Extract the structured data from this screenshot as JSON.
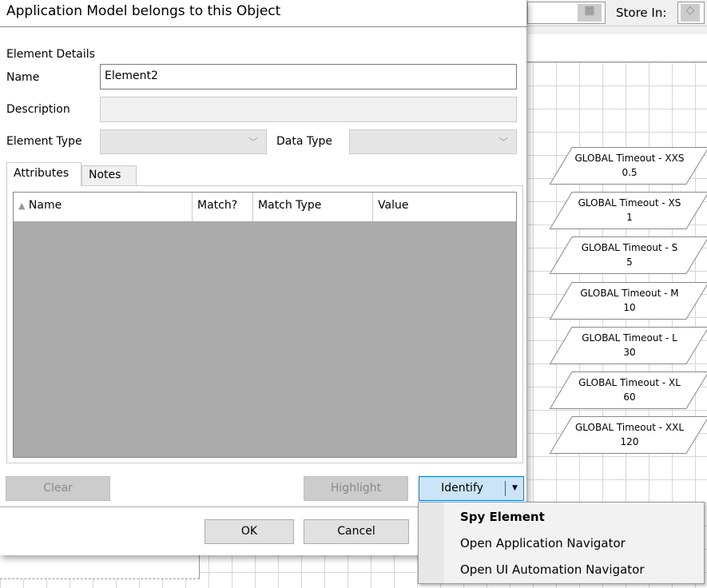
{
  "window": {
    "title": "Application Model belongs to this Object"
  },
  "toolbar": {
    "store_in_label": "Store In:",
    "calculator_icon": "calculator-icon",
    "store_icon": "eraser-icon"
  },
  "canvas": {
    "stages": [
      {
        "name": "GLOBAL Timeout - XXS",
        "value": "0.5"
      },
      {
        "name": "GLOBAL Timeout - XS",
        "value": "1"
      },
      {
        "name": "GLOBAL Timeout - S",
        "value": "5"
      },
      {
        "name": "GLOBAL Timeout - M",
        "value": "10"
      },
      {
        "name": "GLOBAL Timeout - L",
        "value": "30"
      },
      {
        "name": "GLOBAL Timeout - XL",
        "value": "60"
      },
      {
        "name": "GLOBAL Timeout - XXL",
        "value": "120"
      }
    ]
  },
  "details": {
    "section": "Element Details",
    "name_label": "Name",
    "name_value": "Element2",
    "description_label": "Description",
    "description_value": "",
    "element_type_label": "Element Type",
    "element_type_value": "",
    "data_type_label": "Data Type",
    "data_type_value": ""
  },
  "tabs": [
    {
      "label": "Attributes",
      "active": true
    },
    {
      "label": "Notes",
      "active": false
    }
  ],
  "attributes": {
    "columns": [
      "Name",
      "Match?",
      "Match Type",
      "Value"
    ],
    "sort_column": "Name",
    "rows": []
  },
  "buttons": {
    "clear": "Clear",
    "highlight": "Highlight",
    "identify": "Identify",
    "ok": "OK",
    "cancel": "Cancel"
  },
  "identify_menu": [
    "Spy Element",
    "Open Application Navigator",
    "Open UI Automation Navigator"
  ]
}
